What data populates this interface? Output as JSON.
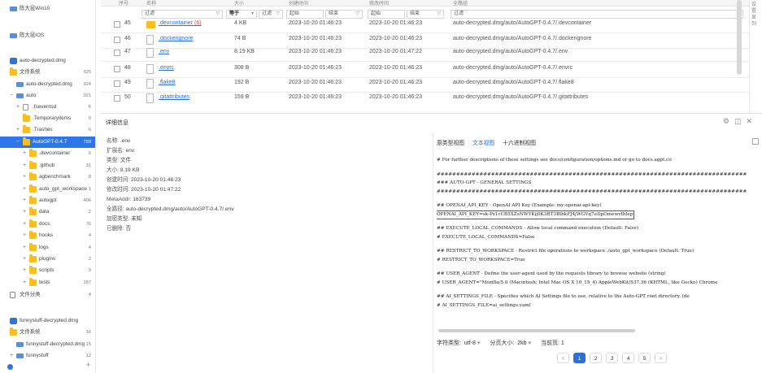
{
  "tree": {
    "items": [
      {
        "label": "陈大昆Win10",
        "count": "",
        "icon": "disk-icon",
        "exp": "",
        "level": 0
      },
      {
        "label": "陈大昆IOS",
        "count": "",
        "icon": "disk-icon",
        "exp": "",
        "level": 0
      },
      {
        "label": "auto-decrypted.dmg",
        "count": "",
        "icon": "dmg-icon",
        "exp": "",
        "level": 0
      },
      {
        "label": "文件系统",
        "count": "925",
        "icon": "folder-icon",
        "exp": "",
        "level": 0
      },
      {
        "label": "auto-decrypted.dmg",
        "count": "924",
        "icon": "disk-icon",
        "exp": "",
        "level": 1
      },
      {
        "label": "auto",
        "count": "921",
        "icon": "disk-icon",
        "exp": "−",
        "level": 1
      },
      {
        "label": ".fseventsd",
        "count": "6",
        "icon": "blank-icon",
        "exp": "+",
        "level": 2
      },
      {
        "label": ".Temporaryitems",
        "count": "0",
        "icon": "folder-icon",
        "exp": "",
        "level": 2
      },
      {
        "label": ".Trashes",
        "count": "6",
        "icon": "folder-icon",
        "exp": "+",
        "level": 2
      },
      {
        "label": "AutoGPT-0.4.7",
        "count": "793",
        "icon": "folder-icon",
        "exp": "−",
        "level": 2
      },
      {
        "label": ".devcontainer",
        "count": "6",
        "icon": "folder-icon",
        "exp": "+",
        "level": 3
      },
      {
        "label": ".github",
        "count": "31",
        "icon": "folder-icon",
        "exp": "+",
        "level": 3
      },
      {
        "label": "agbenchmark",
        "count": "8",
        "icon": "folder-icon",
        "exp": "+",
        "level": 3
      },
      {
        "label": "auto_gpt_workspace",
        "count": "1",
        "icon": "folder-icon",
        "exp": "+",
        "level": 3
      },
      {
        "label": "autogpt",
        "count": "406",
        "icon": "folder-icon",
        "exp": "+",
        "level": 3
      },
      {
        "label": "data",
        "count": "2",
        "icon": "folder-icon",
        "exp": "+",
        "level": 3
      },
      {
        "label": "docs",
        "count": "76",
        "icon": "folder-icon",
        "exp": "+",
        "level": 3
      },
      {
        "label": "hooks",
        "count": "4",
        "icon": "folder-icon",
        "exp": "+",
        "level": 3
      },
      {
        "label": "logs",
        "count": "4",
        "icon": "folder-icon",
        "exp": "+",
        "level": 3
      },
      {
        "label": "plugins",
        "count": "2",
        "icon": "folder-icon",
        "exp": "+",
        "level": 3
      },
      {
        "label": "scripts",
        "count": "9",
        "icon": "folder-icon",
        "exp": "+",
        "level": 3
      },
      {
        "label": "tests",
        "count": "167",
        "icon": "folder-icon",
        "exp": "+",
        "level": 3
      },
      {
        "label": "文件分类",
        "count": "4",
        "icon": "docs-icon",
        "exp": "",
        "level": 0
      },
      {
        "label": "funnystuff-decrypted.dmg",
        "count": "",
        "icon": "dmg-icon",
        "exp": "",
        "level": 0
      },
      {
        "label": "文件系统",
        "count": "16",
        "icon": "folder-icon",
        "exp": "",
        "level": 0
      },
      {
        "label": "funnystuff-decrypted.dmg",
        "count": "15",
        "icon": "disk-icon",
        "exp": "",
        "level": 1
      },
      {
        "label": "funnystuff",
        "count": "12",
        "icon": "disk-icon",
        "exp": "+",
        "level": 1
      }
    ]
  },
  "table": {
    "headers": [
      "序号",
      "名称",
      "大小",
      "创建时间",
      "修改时间",
      "全路径"
    ],
    "filters": {
      "name": "过滤",
      "size_op": "等于",
      "size": "过滤",
      "created_start": "起始",
      "created_end": "结束",
      "modified_start": "起始",
      "modified_end": "结束",
      "path": "过滤"
    },
    "rows": [
      {
        "num": "45",
        "name": ".devcontainer",
        "extra": "(6)",
        "folder": true,
        "size": "4 KB",
        "created": "2023-10-20 01:46:23",
        "modified": "2023-10-20 01:46:23",
        "path": "auto-decrypted.dmg/auto/AutoGPT-0.4.7/.devcontainer"
      },
      {
        "num": "46",
        "name": ".dockerignore",
        "extra": "",
        "folder": false,
        "size": "74 B",
        "created": "2023-10-20 01:46:23",
        "modified": "2023-10-20 01:46:23",
        "path": "auto-decrypted.dmg/auto/AutoGPT-0.4.7/.dockerignore"
      },
      {
        "num": "47",
        "name": ".env",
        "extra": "",
        "folder": false,
        "size": "8.19 KB",
        "created": "2023-10-20 01:46:23",
        "modified": "2023-10-20 01:47:22",
        "path": "auto-decrypted.dmg/auto/AutoGPT-0.4.7/.env"
      },
      {
        "num": "48",
        "name": ".envrc",
        "extra": "",
        "folder": false,
        "size": "308 B",
        "created": "2023-10-20 01:46:23",
        "modified": "2023-10-20 01:46:23",
        "path": "auto-decrypted.dmg/auto/AutoGPT-0.4.7/.envrc"
      },
      {
        "num": "49",
        "name": ".flake8",
        "extra": "",
        "folder": false,
        "size": "192 B",
        "created": "2023-10-20 01:46:23",
        "modified": "2023-10-20 01:46:23",
        "path": "auto-decrypted.dmg/auto/AutoGPT-0.4.7/.flake8"
      },
      {
        "num": "50",
        "name": ".gitattributes",
        "extra": "",
        "folder": false,
        "size": "159 B",
        "created": "2023-10-20 01:46:23",
        "modified": "2023-10-20 01:46:23",
        "path": "auto-decrypted.dmg/auto/AutoGPT-0.4.7/.gitattributes"
      }
    ]
  },
  "right_edge_text": "设\n置\n显\n列",
  "details": {
    "title": "详细信息",
    "meta": [
      {
        "k": "名称:",
        "v": ".env"
      },
      {
        "k": "扩展名:",
        "v": "env"
      },
      {
        "k": "类型:",
        "v": "文件"
      },
      {
        "k": "大小:",
        "v": "8.19 KB"
      },
      {
        "k": "创建时间:",
        "v": "2023-10-20 01:46:23"
      },
      {
        "k": "修改时间:",
        "v": "2023-10-20 01:47:22"
      },
      {
        "k": "MetaAddr:",
        "v": "163739"
      },
      {
        "k": "全路径:",
        "v": "auto-decrypted.dmg/auto/AutoGPT-0.4.7/.env"
      },
      {
        "k": "加密类型:",
        "v": "未知"
      },
      {
        "k": "已删除:",
        "v": "否"
      }
    ],
    "tabs": [
      "原类型视图",
      "文本视图",
      "十六进制视图"
    ],
    "active_tab": 1,
    "code_lines": [
      "# For further descriptions of these settings see docs/configuration/options.md or go to docs.agpt.co",
      "",
      "################################################################################",
      "### AUTO-GPT - GENERAL SETTINGS",
      "################################################################################",
      "",
      "## OPENAI_API_KEY - OpenAI API Key (Example: my-openai-api-key)",
      "OPENAI_API_KEY=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",
      "",
      "## EXECUTE_LOCAL_COMMANDS - Allow local command execution (Default: False)",
      "# EXECUTE_LOCAL_COMMANDS=False",
      "",
      "## RESTRICT_TO_WORKSPACE - Restrict file operations to workspace ./auto_gpt_workspace (Default: True)",
      "# RESTRICT_TO_WORKSPACE=True",
      "",
      "## USER_AGENT - Define the user-agent used by the requests library to browse website (string)",
      "# USER_AGENT=\"Mozilla/5.0 (Macintosh; Intel Mac OS X 10_15_4) AppleWebKit/537.36 (KHTML, like Gecko) Chrome",
      "",
      "## AI_SETTINGS_FILE - Specifies which AI Settings file to use, relative to the Auto-GPT root directory. (de",
      "# AI_SETTINGS_FILE=ai_settings.yaml"
    ],
    "highlight_line": 7,
    "pager": {
      "encoding_label": "字符类型:",
      "encoding": "utf-8",
      "pagesize_label": "分页大小:",
      "pagesize": "2kb",
      "current_label": "当前页:",
      "current": "1",
      "pages": [
        "<",
        "1",
        "2",
        "3",
        "4",
        "5",
        ">"
      ]
    }
  }
}
